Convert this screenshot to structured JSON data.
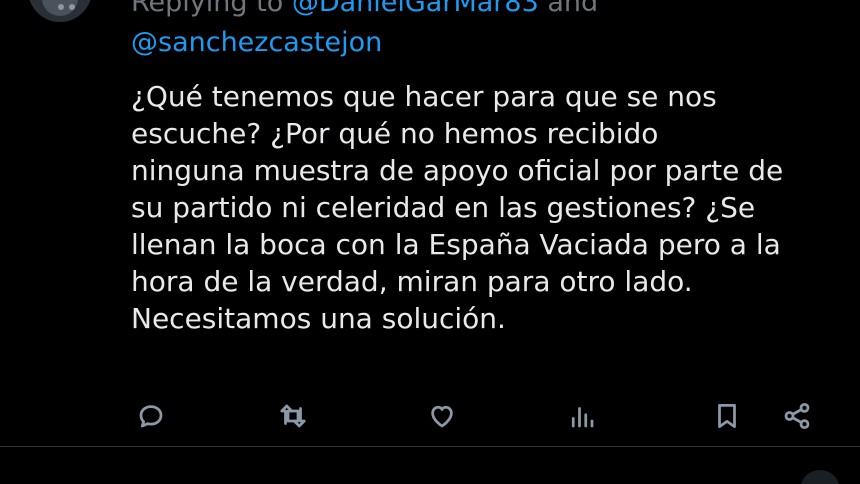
{
  "reply": {
    "replying_prefix": "Replying to",
    "handles_line1": "@DanielGarMar83",
    "conjunction": "and",
    "handles_line2": "@sanchezcastejon"
  },
  "tweet": {
    "text": "¿Qué tenemos que hacer para que se nos\nescuche? ¿Por qué no hemos recibido\nninguna muestra de apoyo oficial por parte de\nsu partido ni celeridad en las gestiones? ¿Se\nllenan la boca con la España Vaciada pero a la\nhora de la verdad, miran para otro lado.\nNecesitamos una solución."
  },
  "actions": {
    "icons": [
      "reply-icon",
      "retweet-icon",
      "like-icon",
      "views-icon",
      "bookmark-icon",
      "share-icon"
    ]
  },
  "colors": {
    "background": "#000000",
    "text": "#e7e9ea",
    "muted": "#71767b",
    "link": "#1d9bf0",
    "icon": "#8b98a5"
  }
}
